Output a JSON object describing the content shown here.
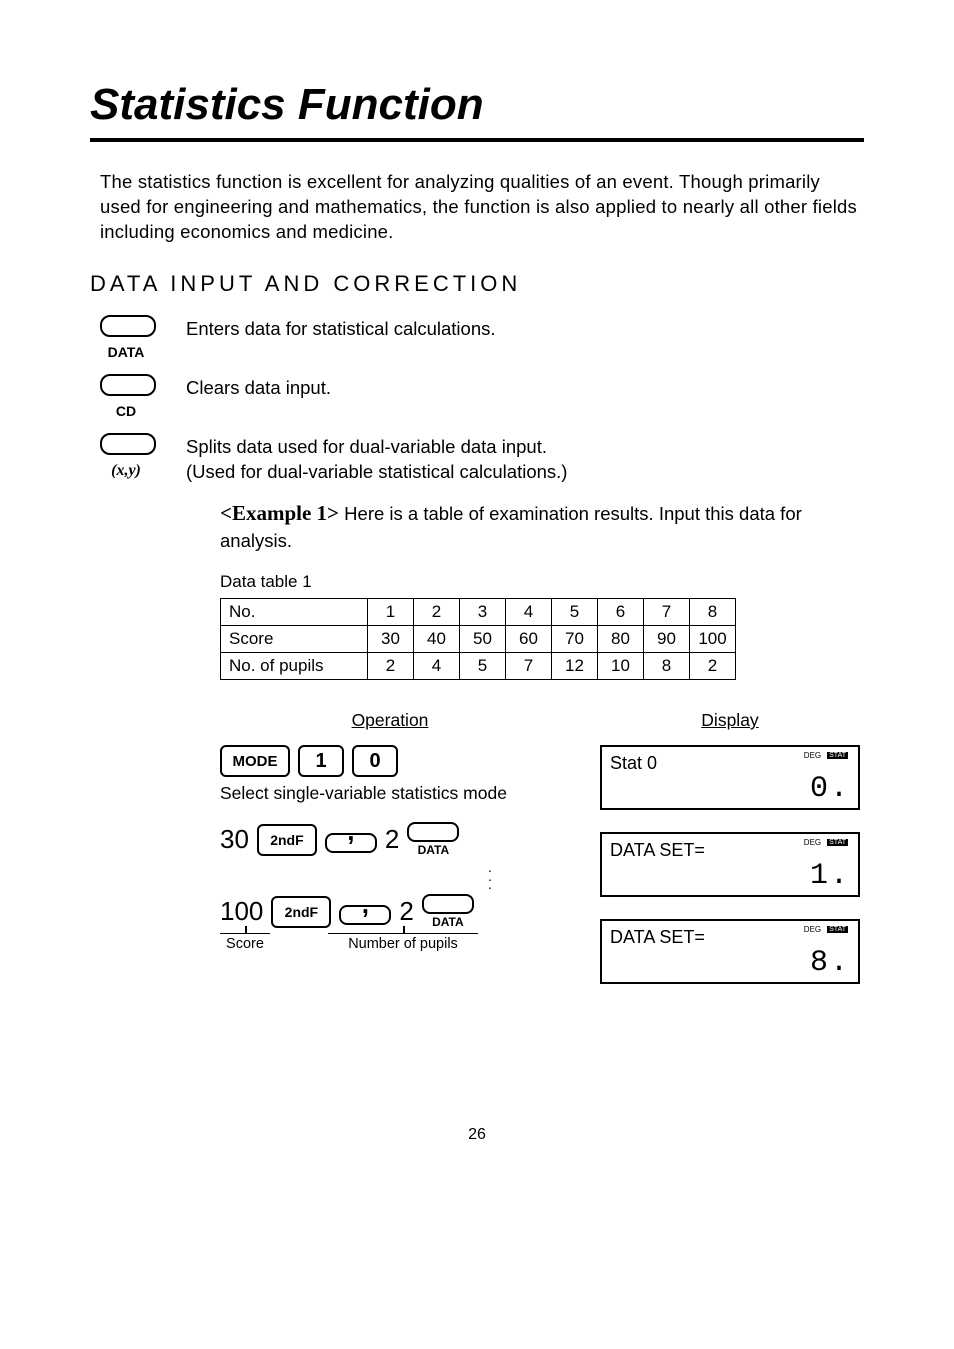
{
  "title": "Statistics Function",
  "intro": "The statistics function is excellent for analyzing qualities of an event. Though primarily used for engineering and mathematics, the function is also applied to nearly all other fields including economics and medicine.",
  "section1": "DATA INPUT AND CORRECTION",
  "keys": {
    "data": {
      "label": "DATA",
      "desc": "Enters data for statistical calculations."
    },
    "cd": {
      "label": "CD",
      "desc": "Clears data input."
    },
    "xy": {
      "label": "(x,y)",
      "desc1": "Splits data used for dual-variable data input.",
      "desc2": "(Used for dual-variable statistical calculations.)"
    }
  },
  "example": {
    "label": "<Example 1>",
    "text": " Here is a table of examination results. Input this data for analysis."
  },
  "table": {
    "caption": "Data table 1",
    "rows": [
      {
        "label": "No.",
        "cells": [
          "1",
          "2",
          "3",
          "4",
          "5",
          "6",
          "7",
          "8"
        ]
      },
      {
        "label": "Score",
        "cells": [
          "30",
          "40",
          "50",
          "60",
          "70",
          "80",
          "90",
          "100"
        ]
      },
      {
        "label": "No. of pupils",
        "cells": [
          "2",
          "4",
          "5",
          "7",
          "12",
          "10",
          "8",
          "2"
        ]
      }
    ]
  },
  "headers": {
    "op": "Operation",
    "disp": "Display"
  },
  "op1": {
    "keys": {
      "mode": "MODE",
      "k1": "1",
      "k0": "0"
    },
    "note": "Select single-variable statistics mode"
  },
  "op2": {
    "pre": "30",
    "sndf": "2ndF",
    "freq": "2",
    "sub": "DATA"
  },
  "op3": {
    "pre": "100",
    "sndf": "2ndF",
    "freq": "2",
    "sub": "DATA",
    "u1": "Score",
    "u2": "Number of pupils"
  },
  "disp1": {
    "line1": "Stat 0",
    "line2": "0.",
    "deg": "DEG",
    "stat": "STAT"
  },
  "disp2": {
    "line1": "DATA SET=",
    "line2": "1.",
    "deg": "DEG",
    "stat": "STAT"
  },
  "disp3": {
    "line1": "DATA SET=",
    "line2": "8.",
    "deg": "DEG",
    "stat": "STAT"
  },
  "pageno": "26"
}
